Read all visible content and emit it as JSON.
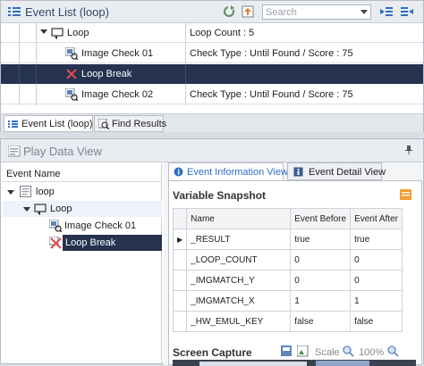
{
  "top_panel": {
    "title": "Event List (loop)",
    "search_placeholder": "Search",
    "rows": [
      {
        "name": "Loop",
        "detail": "Loop Count : 5",
        "icon": "loop-icon"
      },
      {
        "name": "Image Check 01",
        "detail": "Check Type : Until Found / Score : 75",
        "icon": "image-check-icon"
      },
      {
        "name": "Loop Break",
        "detail": "",
        "icon": "loop-break-icon"
      },
      {
        "name": "Image Check 02",
        "detail": "Check Type : Until Found / Score : 75",
        "icon": "image-check-icon"
      }
    ],
    "tabs": [
      "Event List (loop)",
      "Find Results"
    ]
  },
  "play_data_view": {
    "title": "Play Data View",
    "tree_header": "Event Name",
    "tree": [
      "loop",
      "Loop",
      "Image Check 01",
      "Loop Break"
    ],
    "tabs": [
      "Event Information View",
      "Event Detail View"
    ],
    "snapshot_title": "Variable Snapshot",
    "columns": [
      "Name",
      "Event Before",
      "Event After"
    ],
    "variables": [
      {
        "name": "_RESULT",
        "before": "true",
        "after": "true"
      },
      {
        "name": "_LOOP_COUNT",
        "before": "0",
        "after": "0"
      },
      {
        "name": "_IMGMATCH_Y",
        "before": "0",
        "after": "0"
      },
      {
        "name": "_IMGMATCH_X",
        "before": "1",
        "after": "1"
      },
      {
        "name": "_HW_EMUL_KEY",
        "before": "false",
        "after": "false"
      }
    ],
    "screen_capture": "Screen Capture",
    "scale_label": "Scale",
    "scale_value": "100%"
  },
  "colors": {
    "selection": "#253351",
    "accent": "#2f6fc4"
  }
}
